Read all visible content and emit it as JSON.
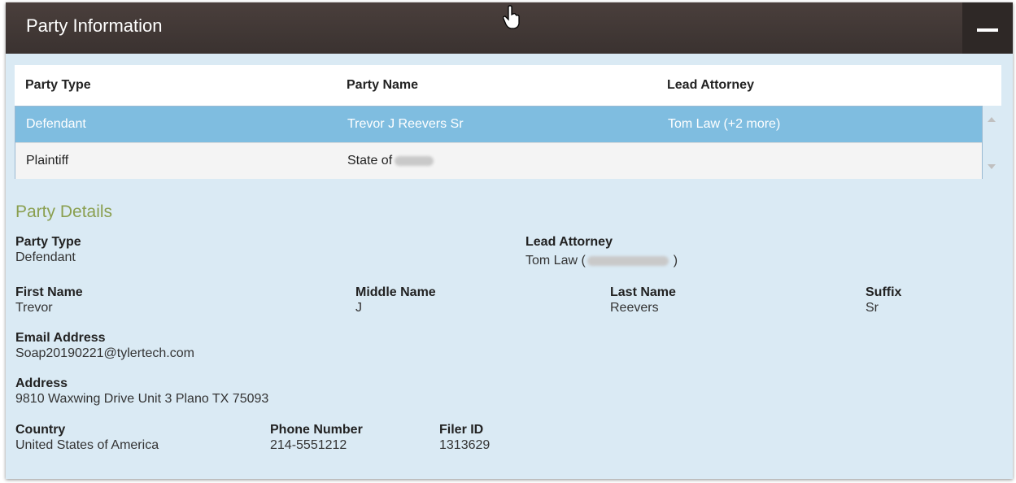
{
  "panel": {
    "title": "Party Information"
  },
  "grid": {
    "columns": [
      "Party Type",
      "Party Name",
      "Lead Attorney"
    ],
    "rows": [
      {
        "party_type": "Defendant",
        "party_name": "Trevor J Reevers Sr",
        "lead_attorney": "Tom Law (+2 more)"
      },
      {
        "party_type": "Plaintiff",
        "party_name": "State of",
        "lead_attorney": ""
      }
    ]
  },
  "details": {
    "title": "Party Details",
    "party_type": {
      "label": "Party Type",
      "value": "Defendant"
    },
    "lead_attorney": {
      "label": "Lead Attorney",
      "value_prefix": "Tom Law (",
      "value_suffix": ")"
    },
    "first_name": {
      "label": "First Name",
      "value": "Trevor"
    },
    "middle_name": {
      "label": "Middle Name",
      "value": "J"
    },
    "last_name": {
      "label": "Last Name",
      "value": "Reevers"
    },
    "suffix": {
      "label": "Suffix",
      "value": "Sr"
    },
    "email": {
      "label": "Email Address",
      "value": "Soap20190221@tylertech.com"
    },
    "address": {
      "label": "Address",
      "value": "9810 Waxwing Drive Unit 3 Plano TX 75093"
    },
    "country": {
      "label": "Country",
      "value": "United States of America"
    },
    "phone": {
      "label": "Phone Number",
      "value": "214-5551212"
    },
    "filer_id": {
      "label": "Filer ID",
      "value": "1313629"
    }
  },
  "icons": {
    "collapse": "minus-icon",
    "cursor": "hand-pointer-icon",
    "scroll_up": "triangle-up-icon",
    "scroll_down": "triangle-down-icon"
  },
  "colors": {
    "header_bg": "#3f3634",
    "panel_bg": "#daeaf4",
    "selected_row": "#7fbde0",
    "section_title": "#8a9f4f"
  }
}
